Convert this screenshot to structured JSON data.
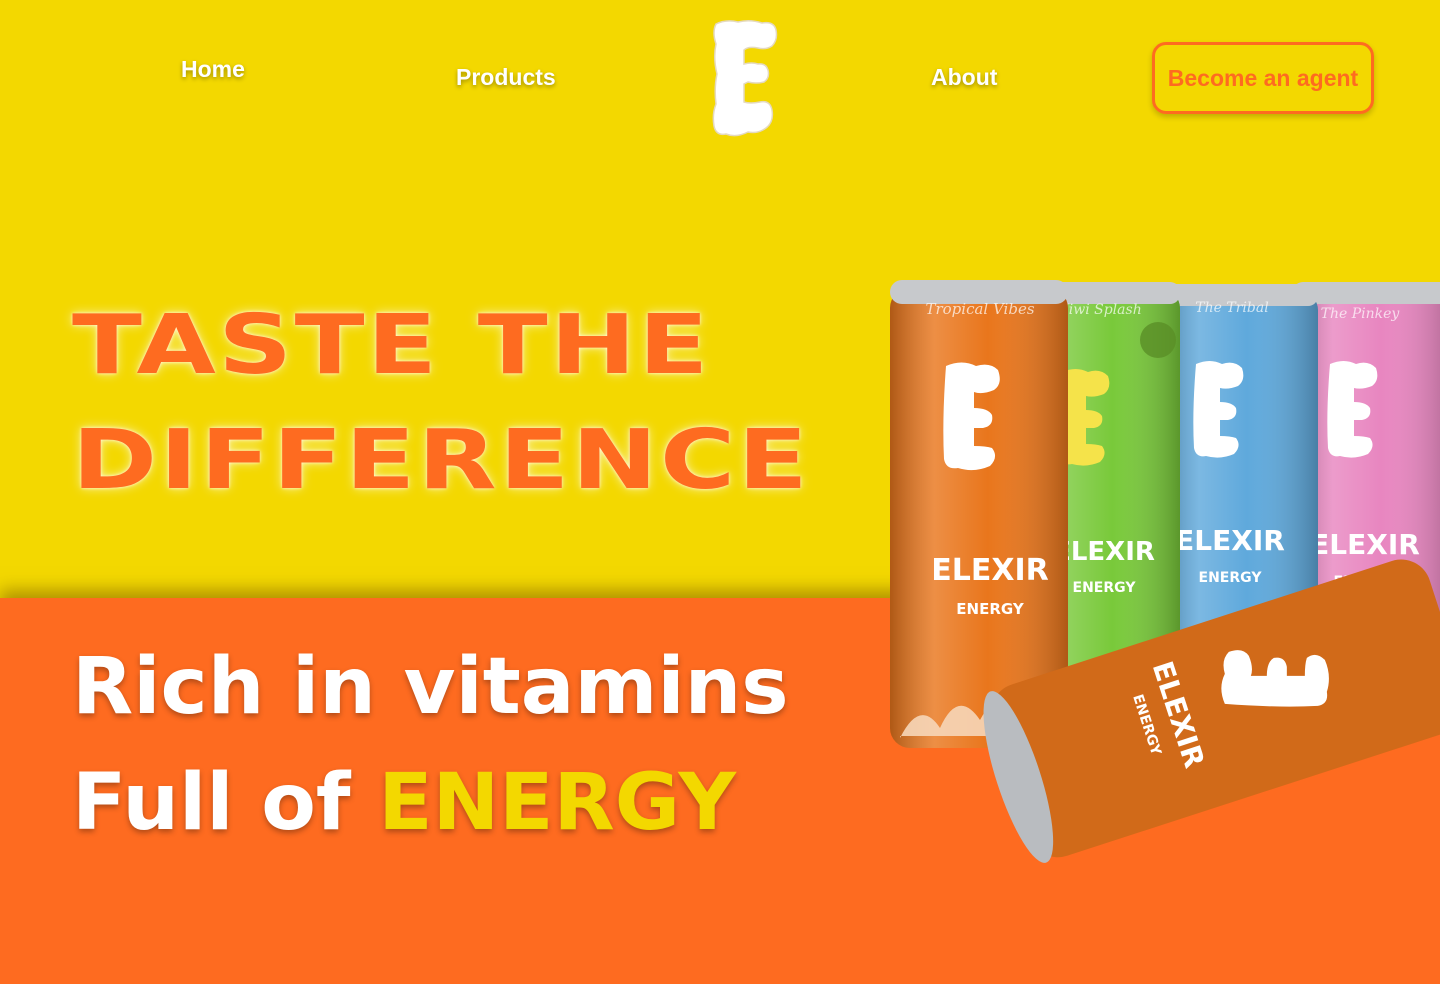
{
  "nav": {
    "home": "Home",
    "products": "Products",
    "about": "About",
    "cta": "Become an agent",
    "logo_icon": "elexir-e-logo-icon"
  },
  "hero": {
    "headline_line1": "TASTE THE",
    "headline_line2": "DIFFERENCE",
    "tagline_line1": "Rich in vitamins",
    "tagline_line2_prefix": "Full of ",
    "tagline_line2_accent": "ENERGY"
  },
  "cans": [
    {
      "flavor": "Tropical Vibes",
      "brand": "ELEXIR",
      "sub": "ENERGY",
      "color": "#e9761c"
    },
    {
      "flavor": "Kiwi Splash",
      "brand": "ELEXIR",
      "sub": "ENERGY",
      "color": "#79c93a"
    },
    {
      "flavor": "The Tribal",
      "brand": "ELEXIR",
      "sub": "ENERGY",
      "color": "#5fa9dc"
    },
    {
      "flavor": "The Pinkey",
      "brand": "ELEXIR",
      "sub": "ENERGY",
      "color": "#e886c0"
    },
    {
      "flavor": "",
      "brand": "ELEXIR",
      "sub": "ENERGY",
      "color": "#e9761c"
    }
  ],
  "colors": {
    "yellow": "#f3d800",
    "orange": "#fe6b20",
    "white": "#ffffff"
  }
}
